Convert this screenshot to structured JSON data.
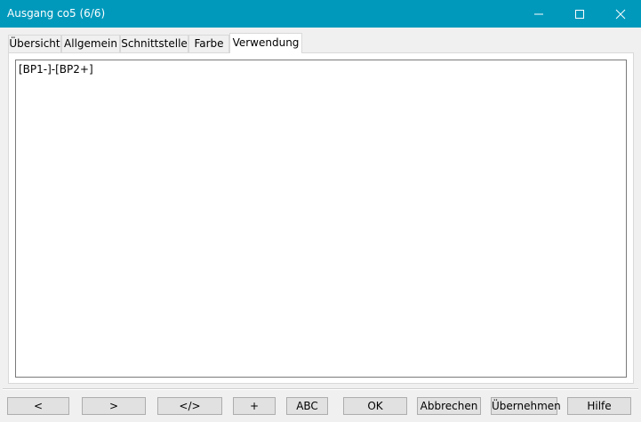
{
  "window": {
    "title": "Ausgang co5 (6/6)",
    "accent_color": "#0099bc",
    "controls": [
      "minimize-icon",
      "maximize-icon",
      "close-icon"
    ]
  },
  "tabs": [
    {
      "label": "Übersicht",
      "active": false
    },
    {
      "label": "Allgemein",
      "active": false
    },
    {
      "label": "Schnittstelle",
      "active": false
    },
    {
      "label": "Farbe",
      "active": false
    },
    {
      "label": "Verwendung",
      "active": true
    }
  ],
  "usage": {
    "text": "[BP1-]-[BP2+]"
  },
  "footer": {
    "prev_label": "<",
    "next_label": ">",
    "code_label": "</>",
    "add_label": "+",
    "abc_label": "ABC",
    "ok_label": "OK",
    "cancel_label": "Abbrechen",
    "apply_label": "Übernehmen",
    "help_label": "Hilfe"
  }
}
